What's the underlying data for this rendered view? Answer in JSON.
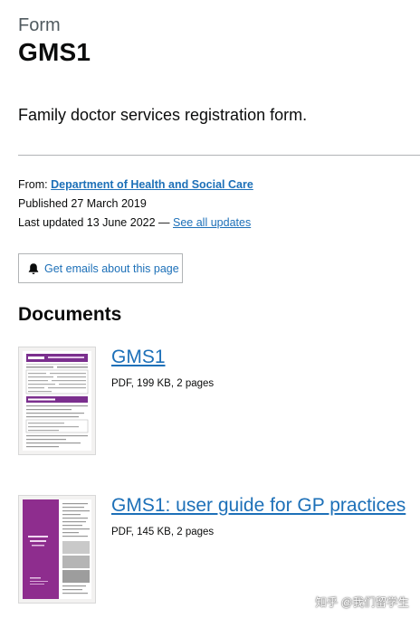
{
  "header": {
    "caption": "Form",
    "title": "GMS1",
    "description": "Family doctor services registration form."
  },
  "metadata": {
    "from_label": "From:",
    "from_link": "Department of Health and Social Care",
    "published_label": "Published",
    "published_date": "27 March 2019",
    "updated_label": "Last updated",
    "updated_date": "13 June 2022",
    "updated_separator": "—",
    "see_all_updates": "See all updates"
  },
  "subscribe": {
    "icon": "bell-icon",
    "label": "Get emails about this page"
  },
  "documents": {
    "heading": "Documents",
    "items": [
      {
        "title": "GMS1",
        "details": "PDF, 199 KB, 2 pages",
        "thumbnail_accent": "#7b2f8e"
      },
      {
        "title": "GMS1: user guide for GP practices",
        "details": "PDF, 145 KB, 2 pages",
        "thumbnail_accent": "#8e2d8e"
      }
    ]
  },
  "watermark": "知乎 @我们留学生",
  "colors": {
    "link": "#1d70b8",
    "text": "#0b0c0c",
    "secondary_text": "#505a5f",
    "border": "#b1b4b6"
  }
}
